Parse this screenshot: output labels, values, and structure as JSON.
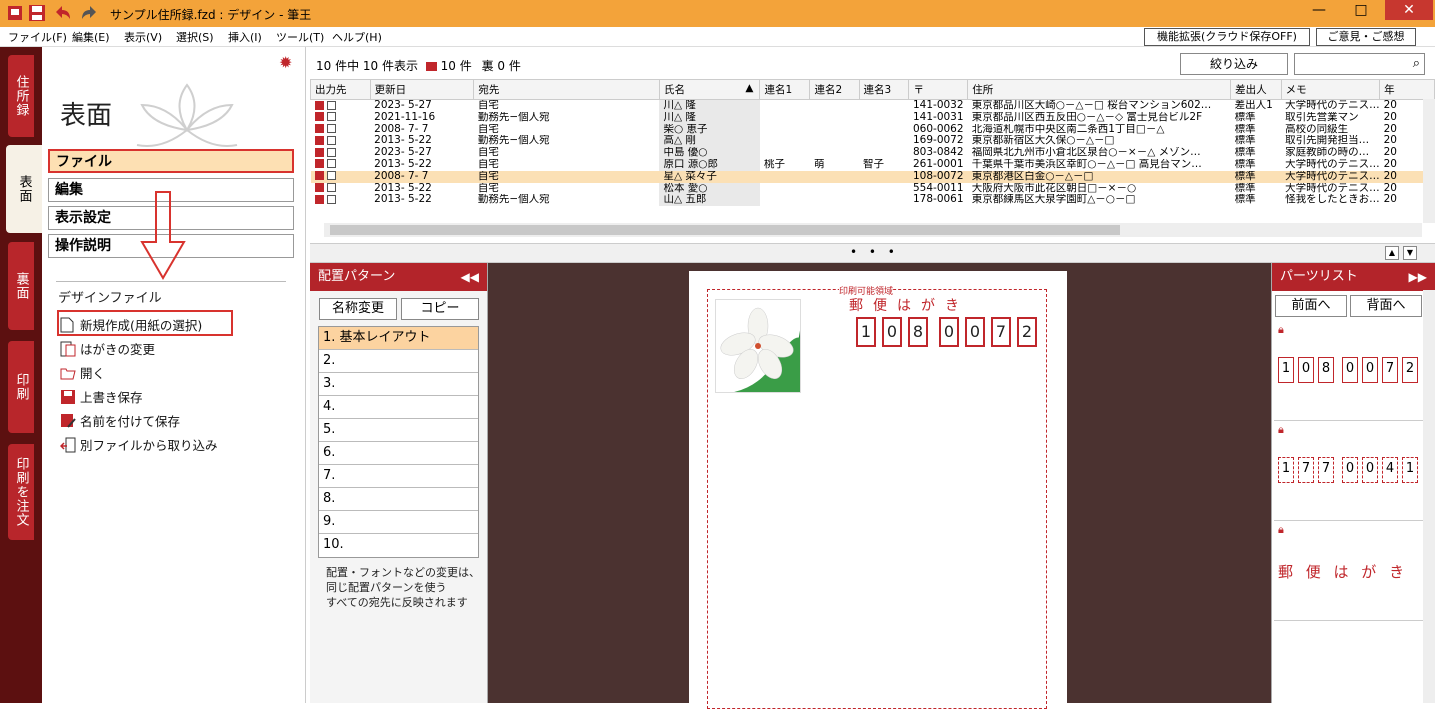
{
  "window": {
    "title": "サンプル住所録.fzd : デザイン - 筆王",
    "minimize": "—",
    "maximize": "□",
    "close": "✕"
  },
  "menu": [
    "ファイル(F)",
    "編集(E)",
    "表示(V)",
    "選択(S)",
    "挿入(I)",
    "ツール(T)",
    "ヘルプ(H)"
  ],
  "top_buttons": {
    "extension": "機能拡張(クラウド保存OFF)",
    "feedback": "ご意見・ご感想"
  },
  "side_tabs": [
    "住所録",
    "表面",
    "裏面",
    "印刷",
    "印刷を注文"
  ],
  "left_panel": {
    "title": "表面",
    "nav": [
      "ファイル",
      "編集",
      "表示設定",
      "操作説明"
    ],
    "section_heading": "デザインファイル",
    "file_items": [
      "新規作成(用紙の選択)",
      "はがきの変更",
      "開く",
      "上書き保存",
      "名前を付けて保存",
      "別ファイルから取り込み"
    ]
  },
  "list": {
    "count_text": "10 件中 10 件表示",
    "front_count": "10 件",
    "back_label": "裏",
    "back_count": "0 件",
    "filter_label": "絞り込み",
    "search_placeholder": "",
    "columns": [
      "出力先",
      "更新日",
      "宛先",
      "氏名",
      "連名1",
      "連名2",
      "連名3",
      "〒",
      "住所",
      "差出人",
      "メモ",
      "年"
    ],
    "sort_indicator": "▲",
    "rows": [
      [
        "2023- 5-27",
        "自宅",
        "川△ 隆",
        "",
        "",
        "",
        "141-0032",
        "東京都品川区大崎○－△－□ 桜台マンション602…",
        "差出人1",
        "大学時代のテニス…",
        "20"
      ],
      [
        "2021-11-16",
        "勤務先−個人宛",
        "川△ 隆",
        "",
        "",
        "",
        "141-0031",
        "東京都品川区西五反田○－△－◇ 富士見台ビル2F",
        "標準",
        "取引先営業マン",
        "20"
      ],
      [
        "2008- 7- 7",
        "自宅",
        "柴○ 恵子",
        "",
        "",
        "",
        "060-0062",
        "北海道札幌市中央区南二条西1丁目□－△",
        "標準",
        "高校の同級生",
        "20"
      ],
      [
        "2013- 5-22",
        "勤務先−個人宛",
        "高△ 剛",
        "",
        "",
        "",
        "169-0072",
        "東京都新宿区大久保○－△－□",
        "標準",
        "取引先開発担当…",
        "20"
      ],
      [
        "2023- 5-27",
        "自宅",
        "中島 優○",
        "",
        "",
        "",
        "803-0842",
        "福岡県北九州市小倉北区泉台○－×－△ メゾン…",
        "標準",
        "家庭教師の時の…",
        "20"
      ],
      [
        "2013- 5-22",
        "自宅",
        "原口 源○郎",
        "桃子",
        "萌",
        "智子",
        "261-0001",
        "千葉県千葉市美浜区幸町○－△－□ 高見台マン…",
        "標準",
        "大学時代のテニス…",
        "20"
      ],
      [
        "2008- 7- 7",
        "自宅",
        "星△ 菜々子",
        "",
        "",
        "",
        "108-0072",
        "東京都港区白金○－△－□",
        "標準",
        "大学時代のテニス…",
        "20"
      ],
      [
        "2013- 5-22",
        "自宅",
        "松本 愛○",
        "",
        "",
        "",
        "554-0011",
        "大阪府大阪市此花区朝日□－×－○",
        "標準",
        "大学時代のテニス…",
        "20"
      ],
      [
        "2013- 5-22",
        "勤務先−個人宛",
        "山△ 五郎",
        "",
        "",
        "",
        "178-0061",
        "東京都練馬区大泉学園町△－○－□",
        "標準",
        "怪我をしたときお…",
        "20"
      ]
    ],
    "highlighted_row": 6
  },
  "splitter": {
    "dots": "• • •",
    "up": "▲",
    "down": "▼"
  },
  "pattern_panel": {
    "title": "配置パターン",
    "collapse": "◀◀",
    "rename": "名称変更",
    "copy": "コピー",
    "items": [
      "1. 基本レイアウト",
      "2.",
      "3.",
      "4.",
      "5.",
      "6.",
      "7.",
      "8.",
      "9.",
      "10."
    ],
    "note": [
      "配置・フォントなどの変更は、",
      "同じ配置パターンを使う",
      "すべての宛先に反映されます"
    ]
  },
  "postcard": {
    "print_area_label": "印刷可能領域",
    "title": "郵便はがき",
    "zip": [
      "1",
      "0",
      "8",
      "0",
      "0",
      "7",
      "2"
    ]
  },
  "parts_panel": {
    "title": "パーツリスト",
    "expand": "▶▶",
    "front": "前面へ",
    "back": "背面へ",
    "part1_zip": [
      "1",
      "0",
      "8",
      "0",
      "0",
      "7",
      "2"
    ],
    "part2_zip": [
      "1",
      "7",
      "7",
      "0",
      "0",
      "4",
      "1"
    ],
    "part3_text": "郵 便 は が き"
  },
  "colors": {
    "accent": "#b3242a",
    "titlebar": "#f3a33a",
    "highlight": "#fbe0b5"
  }
}
